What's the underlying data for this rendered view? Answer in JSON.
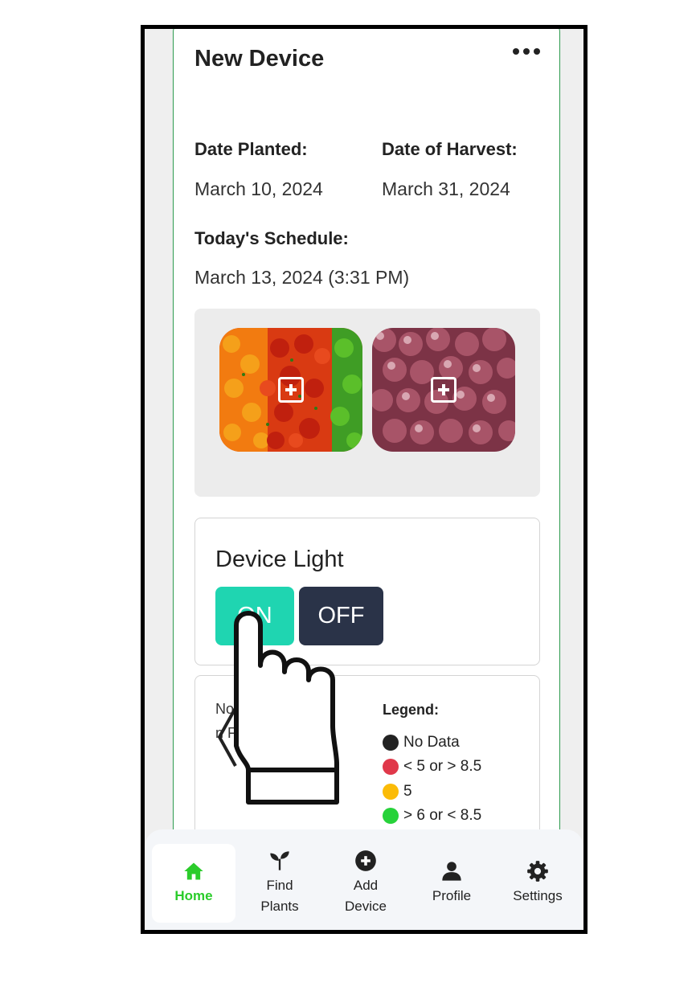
{
  "device": {
    "title": "New Device",
    "more_icon": "more-horizontal-icon"
  },
  "dates": {
    "planted_label": "Date Planted:",
    "planted_value": "March 10, 2024",
    "harvest_label": "Date of Harvest:",
    "harvest_value": "March 31, 2024"
  },
  "schedule": {
    "label": "Today's Schedule:",
    "value": "March 13, 2024 (3:31 PM)"
  },
  "plants": [
    {
      "name": "peppers",
      "icon": "add-square-icon"
    },
    {
      "name": "onions",
      "icon": "add-square-icon"
    }
  ],
  "light": {
    "title": "Device Light",
    "on_label": "ON",
    "off_label": "OFF",
    "on_color": "#1fd5b1",
    "off_color": "#2a3348"
  },
  "status": {
    "fragment_1": "No",
    "fragment_2": "n F",
    "fragment_3": "e"
  },
  "legend": {
    "title": "Legend:",
    "items": [
      {
        "label": "No Data",
        "color": "#222222"
      },
      {
        "label": "< 5 or > 8.5",
        "color": "#e0384a"
      },
      {
        "label": "5",
        "color": "#fbbb07"
      },
      {
        "label": "> 6 or < 8.5",
        "color": "#27d23a"
      }
    ]
  },
  "nav": {
    "active_color": "#2bcc2b",
    "items": [
      {
        "line1": "Home",
        "line2": "",
        "icon": "home-icon"
      },
      {
        "line1": "Find",
        "line2": "Plants",
        "icon": "sprout-icon"
      },
      {
        "line1": "Add",
        "line2": "Device",
        "icon": "plus-circle-icon"
      },
      {
        "line1": "Profile",
        "line2": "",
        "icon": "user-icon"
      },
      {
        "line1": "Settings",
        "line2": "",
        "icon": "gear-icon"
      }
    ]
  },
  "overlay": {
    "icon": "pointing-hand-icon"
  }
}
